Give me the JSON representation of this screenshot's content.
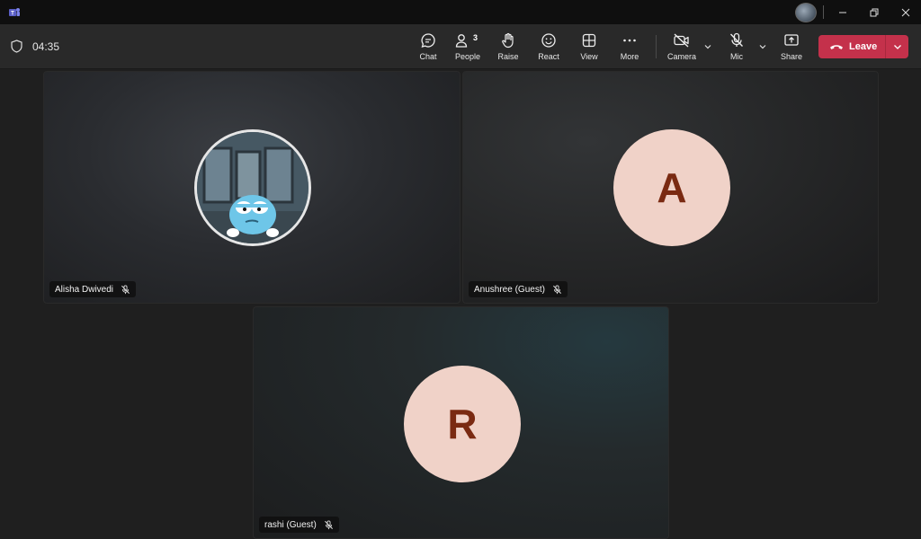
{
  "meeting": {
    "timer": "04:35",
    "participant_count": "3"
  },
  "toolbar": {
    "chat": "Chat",
    "people": "People",
    "raise": "Raise",
    "react": "React",
    "view": "View",
    "more": "More",
    "camera": "Camera",
    "mic": "Mic",
    "share": "Share",
    "leave": "Leave"
  },
  "participants": [
    {
      "name": "Alisha Dwivedi",
      "avatar": "photo",
      "muted": true
    },
    {
      "name": "Anushree (Guest)",
      "initial": "A",
      "muted": true
    },
    {
      "name": "rashi (Guest)",
      "initial": "R",
      "muted": true
    }
  ],
  "colors": {
    "leave": "#c4314b",
    "avatar_bg": "#f0d2c8",
    "avatar_text": "#7a2a12",
    "background": "#1f1f1f"
  },
  "icons": [
    "teams-logo-icon",
    "shield-icon",
    "chat-icon",
    "people-icon",
    "raise-hand-icon",
    "react-icon",
    "view-icon",
    "more-icon",
    "camera-off-icon",
    "mic-off-icon",
    "share-icon",
    "phone-hangup-icon",
    "chevron-down-icon",
    "minimize-icon",
    "restore-icon",
    "close-icon"
  ]
}
